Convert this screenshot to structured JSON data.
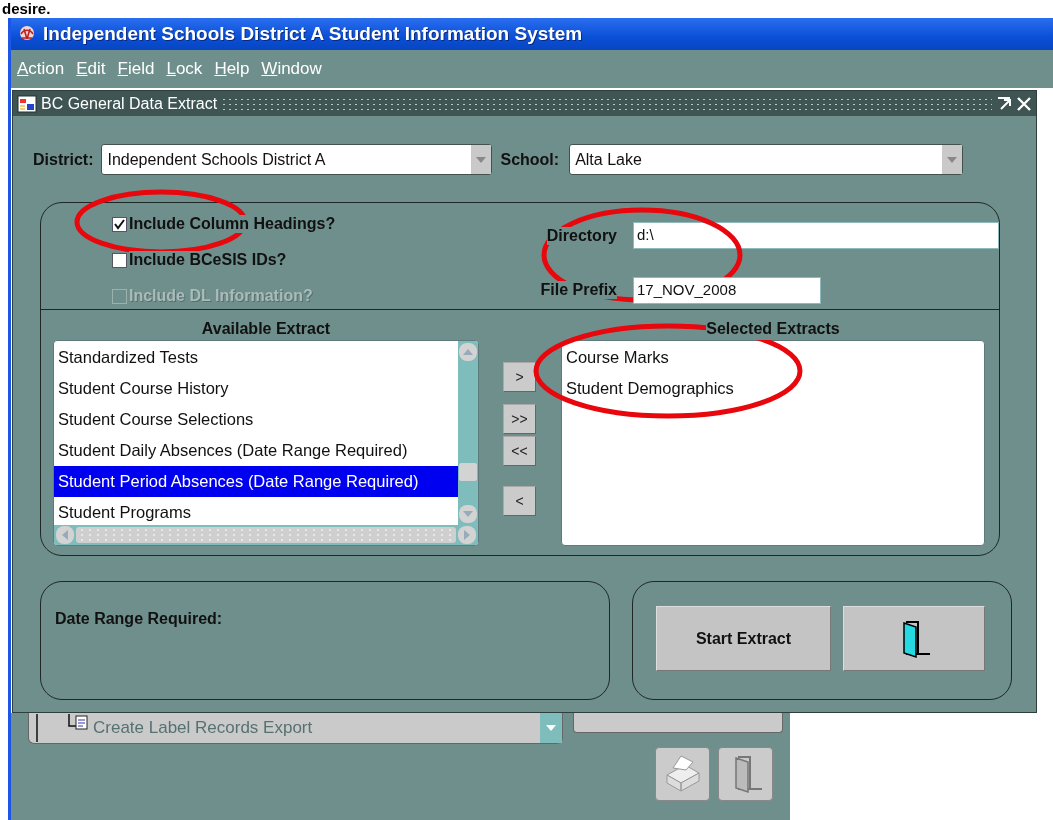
{
  "document_text": "desire.",
  "app": {
    "title": "Independent Schools District A Student Information System",
    "menu": [
      "Action",
      "Edit",
      "Field",
      "Lock",
      "Help",
      "Window"
    ]
  },
  "dialog": {
    "title": "BC General Data Extract",
    "district": {
      "label": "District:",
      "value": "Independent Schools District A"
    },
    "school": {
      "label": "School:",
      "value": "Alta Lake"
    },
    "options": [
      {
        "label": "Include Column Headings?",
        "checked": true,
        "disabled": false
      },
      {
        "label": "Include BCeSIS IDs?",
        "checked": false,
        "disabled": false
      },
      {
        "label": "Include DL Information?",
        "checked": false,
        "disabled": true
      }
    ],
    "directory": {
      "label": "Directory",
      "value": "d:\\"
    },
    "file_prefix": {
      "label": "File Prefix",
      "value": "17_NOV_2008"
    },
    "available": {
      "heading": "Available Extract",
      "items": [
        {
          "label": "Standardized Tests",
          "selected": false
        },
        {
          "label": "Student Course History",
          "selected": false
        },
        {
          "label": "Student Course Selections",
          "selected": false
        },
        {
          "label": "Student Daily Absences (Date Range Required)",
          "selected": false
        },
        {
          "label": "Student Period Absences (Date Range Required)",
          "selected": true
        },
        {
          "label": "Student Programs",
          "selected": false
        }
      ]
    },
    "transfer_buttons": [
      ">",
      ">>",
      "<<",
      "<"
    ],
    "selected_extracts": {
      "heading": "Selected Extracts",
      "items": [
        {
          "label": "Course Marks"
        },
        {
          "label": "Student Demographics"
        }
      ]
    },
    "date_range": {
      "label": "Date Range Required:"
    },
    "start_button": "Start Extract"
  },
  "background": {
    "task": "Create Label Records Export"
  }
}
